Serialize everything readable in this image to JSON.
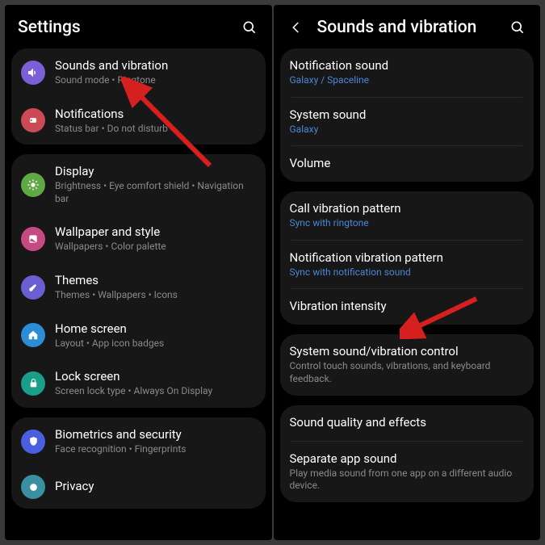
{
  "left": {
    "header": {
      "title": "Settings"
    },
    "groups": [
      {
        "items": [
          {
            "title": "Sounds and vibration",
            "sub": "Sound mode  •  Ringtone",
            "iconColor": "#7a5fd6",
            "icon": "sound"
          },
          {
            "title": "Notifications",
            "sub": "Status bar  •  Do not disturb",
            "iconColor": "#cc4a56",
            "icon": "bell"
          }
        ]
      },
      {
        "items": [
          {
            "title": "Display",
            "sub": "Brightness  •  Eye comfort shield  •  Navigation bar",
            "iconColor": "#5fa843",
            "icon": "sun"
          },
          {
            "title": "Wallpaper and style",
            "sub": "Wallpapers  •  Color palette",
            "iconColor": "#c54a82",
            "icon": "wallpaper"
          },
          {
            "title": "Themes",
            "sub": "Themes  •  Wallpapers  •  Icons",
            "iconColor": "#6a5fd0",
            "icon": "brush"
          },
          {
            "title": "Home screen",
            "sub": "Layout  •  App icon badges",
            "iconColor": "#2a8dd6",
            "icon": "home"
          },
          {
            "title": "Lock screen",
            "sub": "Screen lock type  •  Always On Display",
            "iconColor": "#1a9e89",
            "icon": "lock"
          }
        ]
      },
      {
        "items": [
          {
            "title": "Biometrics and security",
            "sub": "Face recognition  •  Fingerprints",
            "iconColor": "#4a5fe0",
            "icon": "shield"
          },
          {
            "title": "Privacy",
            "sub": "",
            "iconColor": "#3a8fa0",
            "icon": "privacy"
          }
        ]
      }
    ]
  },
  "right": {
    "header": {
      "title": "Sounds and vibration"
    },
    "groups": [
      {
        "items": [
          {
            "title": "Notification sound",
            "sub": "Galaxy / Spaceline",
            "link": true
          },
          {
            "title": "System sound",
            "sub": "Galaxy",
            "link": true
          },
          {
            "title": "Volume",
            "sub": ""
          }
        ]
      },
      {
        "items": [
          {
            "title": "Call vibration pattern",
            "sub": "Sync with ringtone",
            "link": true
          },
          {
            "title": "Notification vibration pattern",
            "sub": "Sync with notification sound",
            "link": true
          },
          {
            "title": "Vibration intensity",
            "sub": ""
          }
        ]
      },
      {
        "items": [
          {
            "title": "System sound/vibration control",
            "sub": "Control touch sounds, vibrations, and keyboard feedback."
          }
        ]
      },
      {
        "items": [
          {
            "title": "Sound quality and effects",
            "sub": ""
          },
          {
            "title": "Separate app sound",
            "sub": "Play media sound from one app on a different audio device."
          }
        ]
      }
    ]
  }
}
